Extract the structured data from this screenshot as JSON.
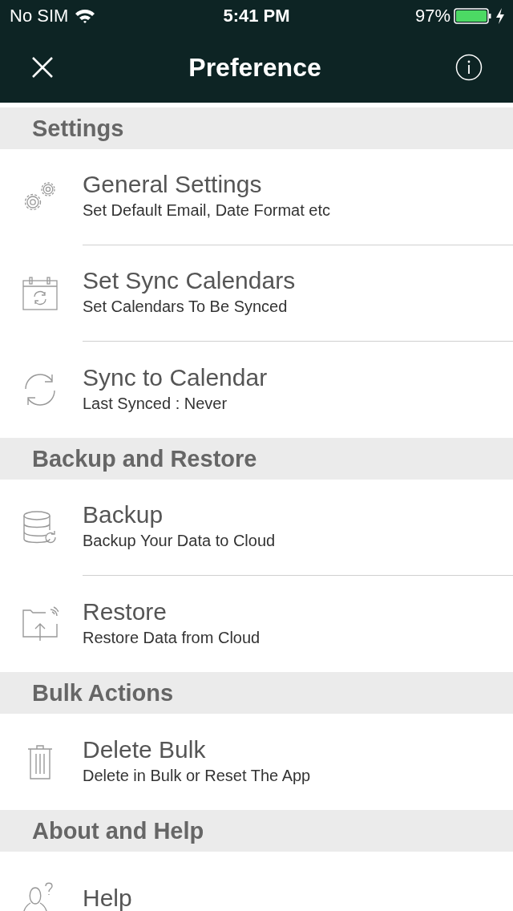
{
  "status_bar": {
    "carrier": "No SIM",
    "time": "5:41 PM",
    "battery": "97%"
  },
  "nav": {
    "title": "Preference"
  },
  "sections": [
    {
      "title": "Settings",
      "items": [
        {
          "title": "General Settings",
          "subtitle": "Set Default Email, Date Format etc"
        },
        {
          "title": "Set Sync Calendars",
          "subtitle": "Set Calendars To Be Synced"
        },
        {
          "title": "Sync to Calendar",
          "subtitle": "Last Synced : Never"
        }
      ]
    },
    {
      "title": "Backup and Restore",
      "items": [
        {
          "title": "Backup",
          "subtitle": "Backup Your Data to Cloud"
        },
        {
          "title": "Restore",
          "subtitle": "Restore Data from Cloud"
        }
      ]
    },
    {
      "title": "Bulk Actions",
      "items": [
        {
          "title": "Delete Bulk",
          "subtitle": "Delete in Bulk or Reset The App"
        }
      ]
    },
    {
      "title": "About and Help",
      "items": [
        {
          "title": "Help"
        }
      ]
    }
  ]
}
